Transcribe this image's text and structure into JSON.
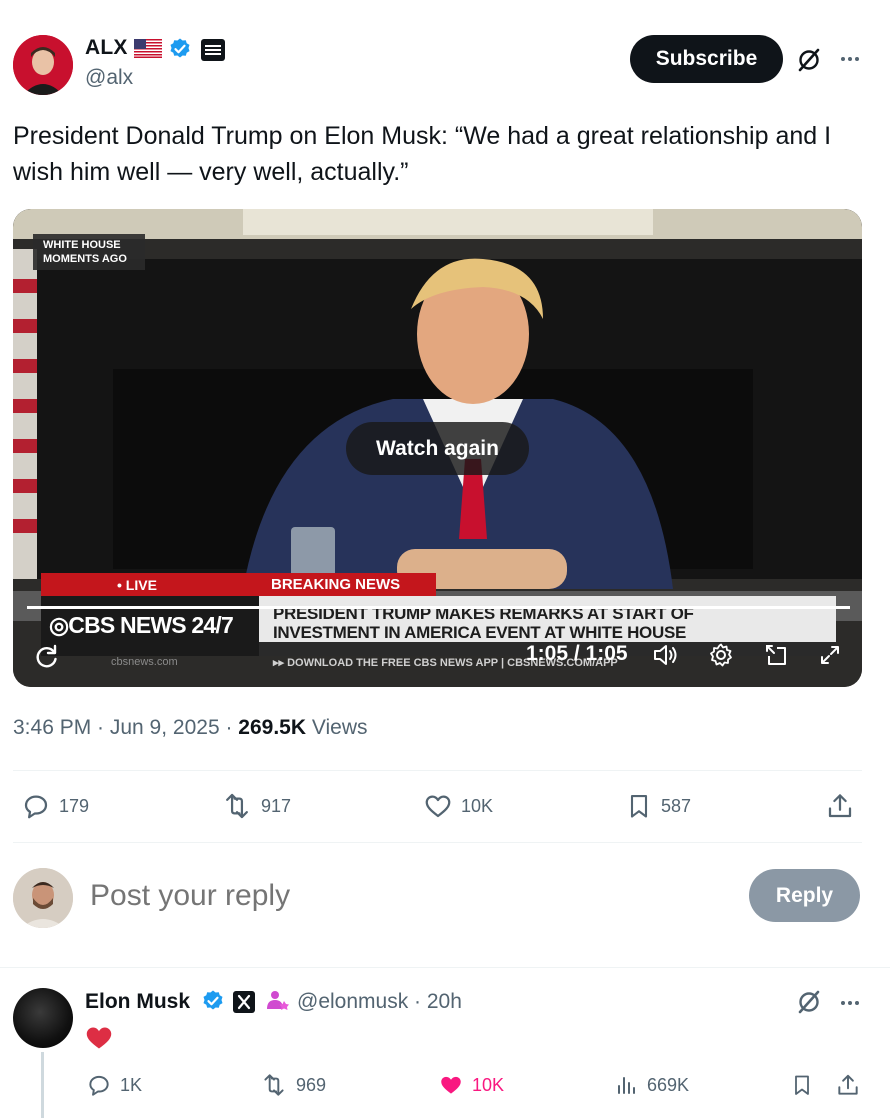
{
  "author": {
    "name": "ALX",
    "handle": "@alx",
    "subscribe_label": "Subscribe"
  },
  "tweet": {
    "text": "President Donald Trump on Elon Musk: “We had a great relationship and I wish him well — very well, actually.”",
    "time": "3:46 PM · Jun 9, 2025 · ",
    "views_count": "269.5K",
    "views_label": " Views"
  },
  "video": {
    "overlay_label": "WHITE HOUSE",
    "overlay_label2": "MOMENTS AGO",
    "live_label": "• LIVE",
    "breaking_label": "BREAKING NEWS",
    "network": "CBS NEWS 24/7",
    "headline1": "PRESIDENT TRUMP MAKES REMARKS AT START OF",
    "headline2": "INVESTMENT IN AMERICA EVENT AT WHITE HOUSE",
    "ticker": "▸▸ DOWNLOAD THE FREE CBS NEWS APP | CBSNEWS.COM/APP",
    "site": "cbsnews.com",
    "watch_again": "Watch again",
    "time_display": "1:05 / 1:05",
    "progress": 1.0
  },
  "actions": {
    "replies": "179",
    "reposts": "917",
    "likes": "10K",
    "bookmarks": "587"
  },
  "composer": {
    "placeholder": "Post your reply",
    "reply_label": "Reply"
  },
  "reply_tweet": {
    "name": "Elon Musk",
    "handle": "@elonmusk · 20h",
    "replies": "1K",
    "reposts": "969",
    "likes": "10K",
    "views": "669K"
  },
  "colors": {
    "accent": "#1d9bf0",
    "like_pink": "#f91880",
    "muted": "#536471"
  },
  "icons": [
    "flag-us-icon",
    "verified-icon",
    "grok-icon",
    "more-icon",
    "replay-icon",
    "volume-icon",
    "settings-icon",
    "pip-icon",
    "fullscreen-icon",
    "reply-icon",
    "repost-icon",
    "like-icon",
    "bookmark-icon",
    "share-icon",
    "views-icon",
    "heart-emoji-icon"
  ]
}
